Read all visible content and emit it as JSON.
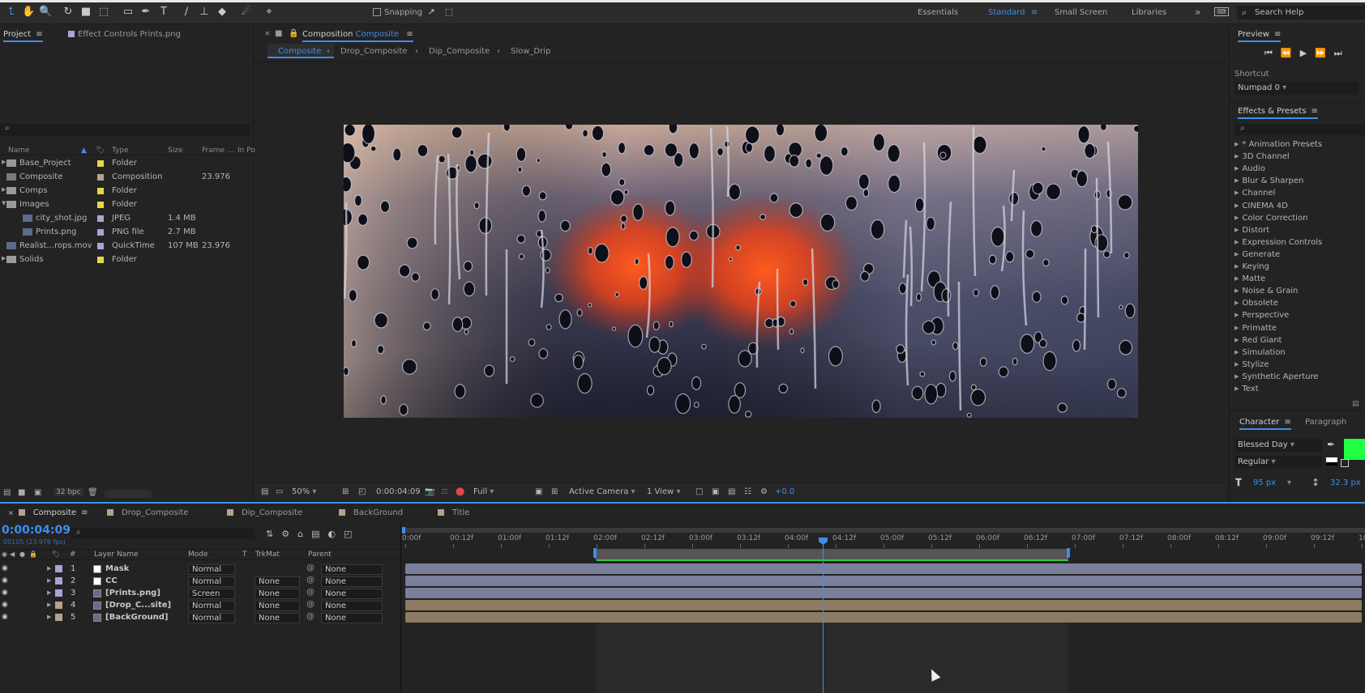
{
  "toolbar": {
    "snapping_label": "Snapping",
    "workspaces": [
      "Essentials",
      "Standard",
      "Small Screen",
      "Libraries"
    ],
    "active_workspace": "Standard",
    "search_placeholder": "Search Help"
  },
  "project_panel": {
    "tabs": [
      "Project",
      "Effect Controls Prints.png"
    ],
    "columns": [
      "Name",
      "Type",
      "Size",
      "Frame ...",
      "In Po"
    ],
    "items": [
      {
        "name": "Base_Project",
        "type": "Folder",
        "size": "",
        "fps": "",
        "color": "#e6d84a"
      },
      {
        "name": "Composite",
        "type": "Composition",
        "size": "",
        "fps": "23.976",
        "color": "#b5a28a"
      },
      {
        "name": "Comps",
        "type": "Folder",
        "size": "",
        "fps": "",
        "color": "#e6d84a"
      },
      {
        "name": "Images",
        "type": "Folder",
        "size": "",
        "fps": "",
        "color": "#e6d84a"
      },
      {
        "name": "city_shot.jpg",
        "type": "JPEG",
        "size": "1.4 MB",
        "fps": "",
        "color": "#a9a3d8"
      },
      {
        "name": "Prints.png",
        "type": "PNG file",
        "size": "2.7 MB",
        "fps": "",
        "color": "#a9a3d8"
      },
      {
        "name": "Realist...rops.mov",
        "type": "QuickTime",
        "size": "107 MB",
        "fps": "23.976",
        "color": "#a9a3d8"
      },
      {
        "name": "Solids",
        "type": "Folder",
        "size": "",
        "fps": "",
        "color": "#e6d84a"
      }
    ],
    "bpc": "32 bpc"
  },
  "composition_panel": {
    "title_prefix": "Composition",
    "title": "Composite",
    "breadcrumbs": [
      "Composite",
      "Drop_Composite",
      "Dip_Composite",
      "Slow_Drip"
    ],
    "zoom": "50%",
    "timecode": "0:00:04:09",
    "resolution": "Full",
    "camera": "Active Camera",
    "view": "1 View",
    "exposure": "+0.0"
  },
  "preview_panel": {
    "title": "Preview",
    "shortcut_label": "Shortcut",
    "shortcut_value": "Numpad 0"
  },
  "effects_panel": {
    "title": "Effects & Presets",
    "items": [
      "* Animation Presets",
      "3D Channel",
      "Audio",
      "Blur & Sharpen",
      "Channel",
      "CINEMA 4D",
      "Color Correction",
      "Distort",
      "Expression Controls",
      "Generate",
      "Keying",
      "Matte",
      "Noise & Grain",
      "Obsolete",
      "Perspective",
      "Primatte",
      "Red Giant",
      "Simulation",
      "Stylize",
      "Synthetic Aperture",
      "Text"
    ]
  },
  "character_panel": {
    "tabs": [
      "Character",
      "Paragraph"
    ],
    "font": "Blessed Day",
    "style": "Regular",
    "font_size": "95 px",
    "leading": "32.3 px",
    "fill_color": "#22ff44"
  },
  "timeline": {
    "tabs": [
      "Composite",
      "Drop_Composite",
      "Dip_Composite",
      "BackGround",
      "Title"
    ],
    "tab_colors": [
      "#b5a28a",
      "#b5a28a",
      "#b5a28a",
      "#b5a28a",
      "#b5a28a"
    ],
    "timecode": "0:00:04:09",
    "frame_info": "00105 (23.976 fps)",
    "columns": [
      "Layer Name",
      "Mode",
      "T",
      "TrkMat",
      "Parent"
    ],
    "layers": [
      {
        "num": "1",
        "name": "Mask",
        "mode": "Normal",
        "trkmat": "",
        "parent": "None",
        "color": "#a9a3d8",
        "bar": "#7a7f9c"
      },
      {
        "num": "2",
        "name": "CC",
        "mode": "Normal",
        "trkmat": "None",
        "parent": "None",
        "color": "#a9a3d8",
        "bar": "#7a7f9c"
      },
      {
        "num": "3",
        "name": "[Prints.png]",
        "mode": "Screen",
        "trkmat": "None",
        "parent": "None",
        "color": "#a9a3d8",
        "bar": "#7a7f9c"
      },
      {
        "num": "4",
        "name": "[Drop_C...site]",
        "mode": "Normal",
        "trkmat": "None",
        "parent": "None",
        "color": "#b5a28a",
        "bar": "#8c7b62"
      },
      {
        "num": "5",
        "name": "[BackGround]",
        "mode": "Normal",
        "trkmat": "None",
        "parent": "None",
        "color": "#b5a28a",
        "bar": "#8c7b62"
      }
    ],
    "ruler": [
      "0:00f",
      "00:12f",
      "01:00f",
      "01:12f",
      "02:00f",
      "02:12f",
      "03:00f",
      "03:12f",
      "04:00f",
      "04:12f",
      "05:00f",
      "05:12f",
      "06:00f",
      "06:12f",
      "07:00f",
      "07:12f",
      "08:00f",
      "08:12f",
      "09:00f",
      "09:12f",
      "10:0"
    ]
  }
}
